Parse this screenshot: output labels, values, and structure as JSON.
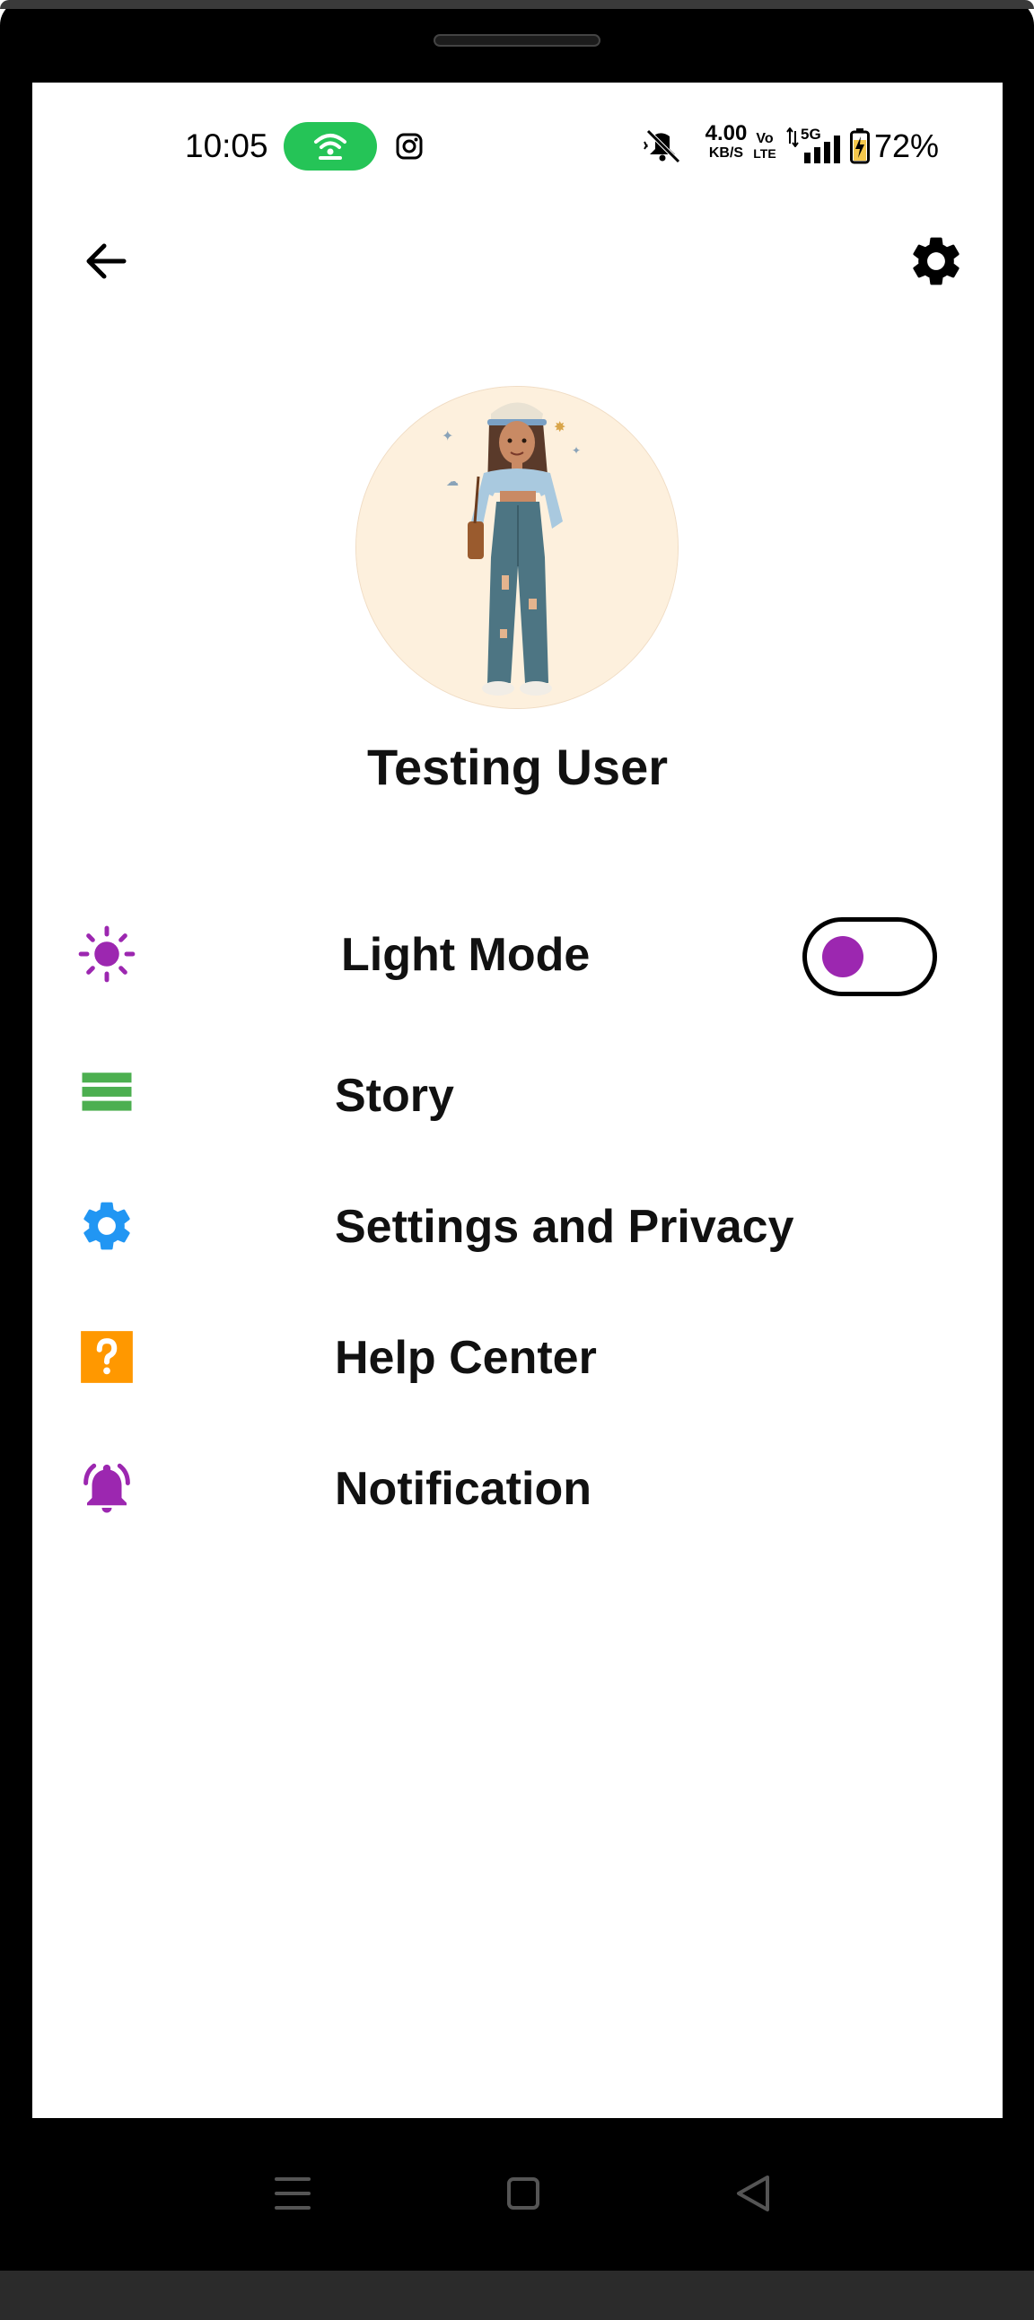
{
  "status_bar": {
    "time": "10:05",
    "net_speed_value": "4.00",
    "net_speed_unit": "KB/S",
    "volte_top": "Vo",
    "volte_bottom": "LTE",
    "network_type": "5G",
    "battery_percent": "72%",
    "icons": [
      "hotspot-icon",
      "instagram-icon",
      "mute-icon",
      "signal-icon",
      "battery-icon"
    ],
    "hotspot_color": "#25c457"
  },
  "app_bar": {
    "icons": [
      "back-arrow-icon",
      "settings-gear-icon"
    ]
  },
  "profile": {
    "name": "Testing User"
  },
  "menu": {
    "items": [
      {
        "label": "Light Mode",
        "icon": "sun-icon",
        "icon_color": "#9c27b0",
        "toggle": true
      },
      {
        "label": "Story",
        "icon": "list-icon",
        "icon_color": "#4caf50"
      },
      {
        "label": "Settings and Privacy",
        "icon": "gear-icon",
        "icon_color": "#2196f3"
      },
      {
        "label": "Help Center",
        "icon": "help-icon",
        "icon_color": "#ff9800"
      },
      {
        "label": "Notification",
        "icon": "bell-icon",
        "icon_color": "#9c27b0"
      }
    ],
    "toggle_knob_color": "#9c27b0"
  },
  "nav_bar": {
    "icons": [
      "menu-icon",
      "home-icon",
      "back-icon"
    ]
  }
}
